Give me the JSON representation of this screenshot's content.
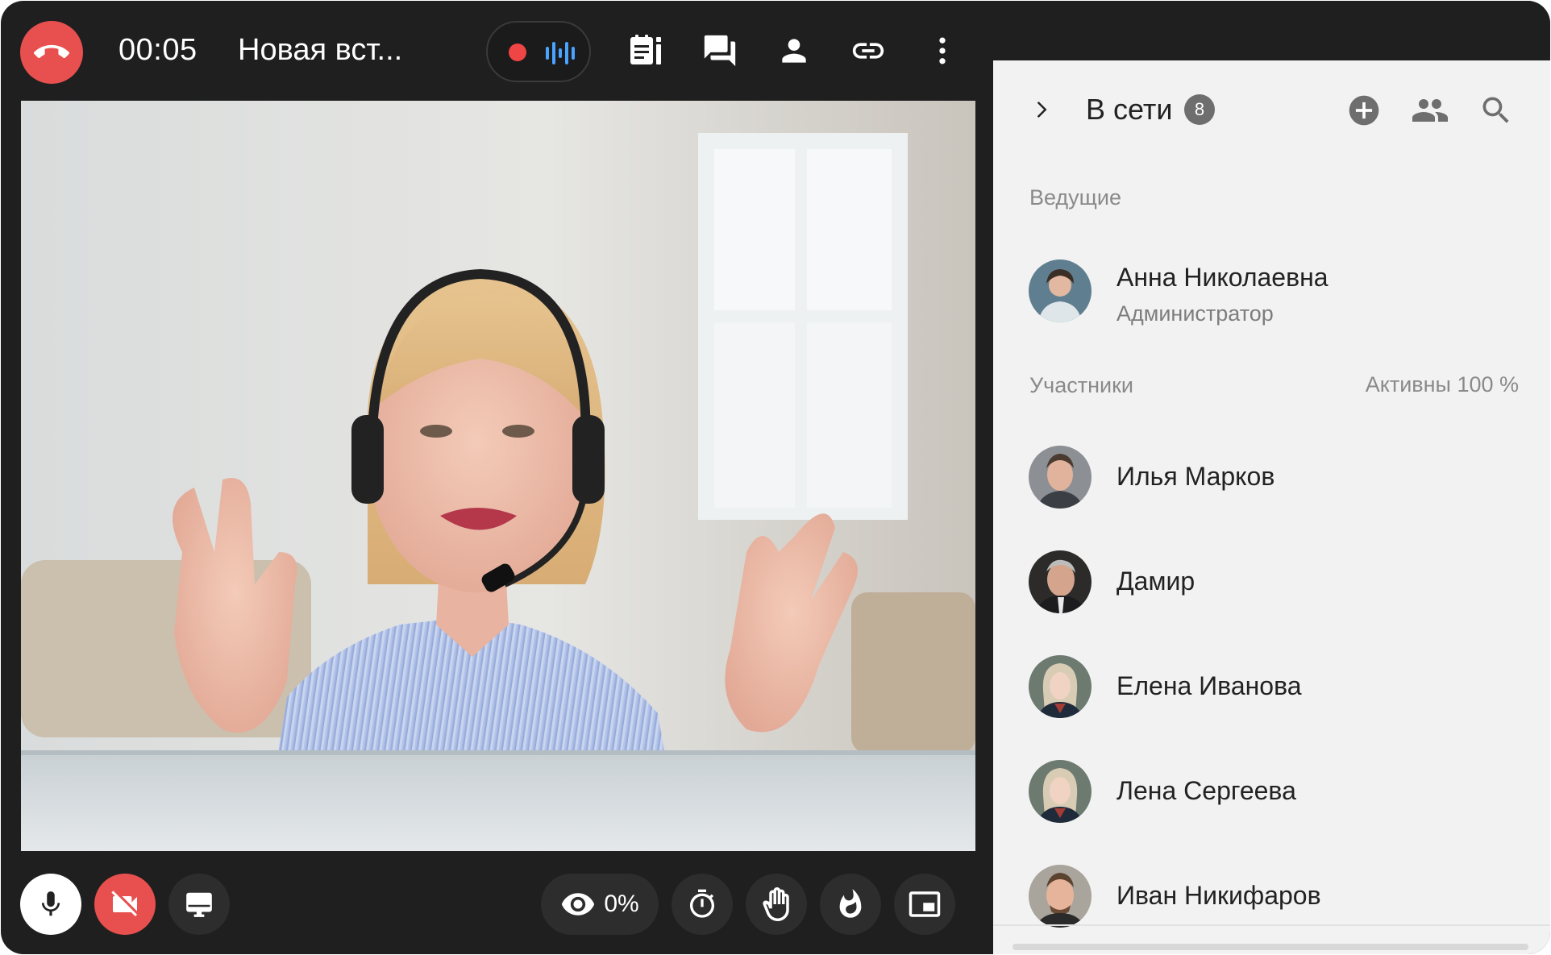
{
  "call": {
    "timer": "00:05",
    "title": "Новая вст..."
  },
  "sidebar": {
    "title": "В сети",
    "online_count": "8",
    "hosts_label": "Ведущие",
    "participants_label": "Участники",
    "active_label": "Активны 100 %",
    "host": {
      "name": "Анна Николаевна",
      "role": "Администратор"
    },
    "participants": [
      {
        "name": "Илья Марков"
      },
      {
        "name": "Дамир"
      },
      {
        "name": "Елена Иванова"
      },
      {
        "name": "Лена Сергеева"
      },
      {
        "name": "Иван Никифаров"
      }
    ]
  },
  "bottom": {
    "views_percent": "0%"
  },
  "colors": {
    "hangup": "#e8504f",
    "camera_off": "#e8504f",
    "rec_dot": "#ef4545",
    "rec_wave": "#4aa3ff",
    "panel_bg": "#f2f2f2",
    "toolbar_bg": "#1f1f1f"
  },
  "icons": {
    "top": [
      "phone-hangup-icon",
      "record-dot-icon",
      "audio-wave-icon",
      "notes-icon",
      "chat-icon",
      "person-icon",
      "link-icon",
      "more-vertical-icon"
    ],
    "sidebar": [
      "chevron-right-icon",
      "add-circle-icon",
      "group-icon",
      "search-icon"
    ],
    "bottom": [
      "microphone-icon",
      "camera-off-icon",
      "screen-share-icon",
      "eye-icon",
      "timer-icon",
      "raise-hand-icon",
      "fire-icon",
      "picture-in-picture-icon"
    ]
  }
}
